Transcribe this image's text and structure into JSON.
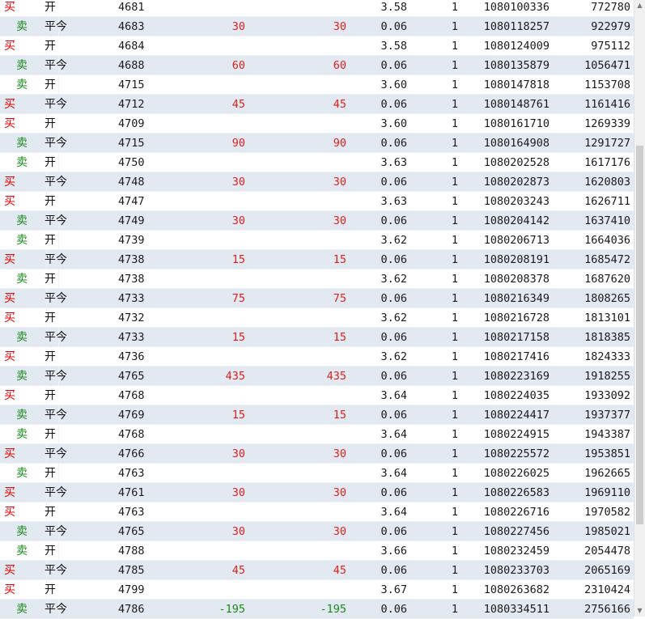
{
  "colors": {
    "buy": "#e60000",
    "sell": "#1a8a1a",
    "row_alt": "#e3e9f1"
  },
  "rows": [
    {
      "side": "买",
      "oc": "开",
      "price": "4681",
      "pnl": "",
      "pnl2": "",
      "fee": "3.58",
      "qty": "1",
      "time": "1080100336",
      "idx": "772780"
    },
    {
      "side": "卖",
      "oc": "平今",
      "price": "4683",
      "pnl": "30",
      "pnl2": "30",
      "fee": "0.06",
      "qty": "1",
      "time": "1080118257",
      "idx": "922979"
    },
    {
      "side": "买",
      "oc": "开",
      "price": "4684",
      "pnl": "",
      "pnl2": "",
      "fee": "3.58",
      "qty": "1",
      "time": "1080124009",
      "idx": "975112"
    },
    {
      "side": "卖",
      "oc": "平今",
      "price": "4688",
      "pnl": "60",
      "pnl2": "60",
      "fee": "0.06",
      "qty": "1",
      "time": "1080135879",
      "idx": "1056471"
    },
    {
      "side": "卖",
      "oc": "开",
      "price": "4715",
      "pnl": "",
      "pnl2": "",
      "fee": "3.60",
      "qty": "1",
      "time": "1080147818",
      "idx": "1153708"
    },
    {
      "side": "买",
      "oc": "平今",
      "price": "4712",
      "pnl": "45",
      "pnl2": "45",
      "fee": "0.06",
      "qty": "1",
      "time": "1080148761",
      "idx": "1161416"
    },
    {
      "side": "买",
      "oc": "开",
      "price": "4709",
      "pnl": "",
      "pnl2": "",
      "fee": "3.60",
      "qty": "1",
      "time": "1080161710",
      "idx": "1269339"
    },
    {
      "side": "卖",
      "oc": "平今",
      "price": "4715",
      "pnl": "90",
      "pnl2": "90",
      "fee": "0.06",
      "qty": "1",
      "time": "1080164908",
      "idx": "1291727"
    },
    {
      "side": "卖",
      "oc": "开",
      "price": "4750",
      "pnl": "",
      "pnl2": "",
      "fee": "3.63",
      "qty": "1",
      "time": "1080202528",
      "idx": "1617176"
    },
    {
      "side": "买",
      "oc": "平今",
      "price": "4748",
      "pnl": "30",
      "pnl2": "30",
      "fee": "0.06",
      "qty": "1",
      "time": "1080202873",
      "idx": "1620803"
    },
    {
      "side": "买",
      "oc": "开",
      "price": "4747",
      "pnl": "",
      "pnl2": "",
      "fee": "3.63",
      "qty": "1",
      "time": "1080203243",
      "idx": "1626711"
    },
    {
      "side": "卖",
      "oc": "平今",
      "price": "4749",
      "pnl": "30",
      "pnl2": "30",
      "fee": "0.06",
      "qty": "1",
      "time": "1080204142",
      "idx": "1637410"
    },
    {
      "side": "卖",
      "oc": "开",
      "price": "4739",
      "pnl": "",
      "pnl2": "",
      "fee": "3.62",
      "qty": "1",
      "time": "1080206713",
      "idx": "1664036"
    },
    {
      "side": "买",
      "oc": "平今",
      "price": "4738",
      "pnl": "15",
      "pnl2": "15",
      "fee": "0.06",
      "qty": "1",
      "time": "1080208191",
      "idx": "1685472"
    },
    {
      "side": "卖",
      "oc": "开",
      "price": "4738",
      "pnl": "",
      "pnl2": "",
      "fee": "3.62",
      "qty": "1",
      "time": "1080208378",
      "idx": "1687620"
    },
    {
      "side": "买",
      "oc": "平今",
      "price": "4733",
      "pnl": "75",
      "pnl2": "75",
      "fee": "0.06",
      "qty": "1",
      "time": "1080216349",
      "idx": "1808265"
    },
    {
      "side": "买",
      "oc": "开",
      "price": "4732",
      "pnl": "",
      "pnl2": "",
      "fee": "3.62",
      "qty": "1",
      "time": "1080216728",
      "idx": "1813101"
    },
    {
      "side": "卖",
      "oc": "平今",
      "price": "4733",
      "pnl": "15",
      "pnl2": "15",
      "fee": "0.06",
      "qty": "1",
      "time": "1080217158",
      "idx": "1818385"
    },
    {
      "side": "买",
      "oc": "开",
      "price": "4736",
      "pnl": "",
      "pnl2": "",
      "fee": "3.62",
      "qty": "1",
      "time": "1080217416",
      "idx": "1824333"
    },
    {
      "side": "卖",
      "oc": "平今",
      "price": "4765",
      "pnl": "435",
      "pnl2": "435",
      "fee": "0.06",
      "qty": "1",
      "time": "1080223169",
      "idx": "1918255"
    },
    {
      "side": "买",
      "oc": "开",
      "price": "4768",
      "pnl": "",
      "pnl2": "",
      "fee": "3.64",
      "qty": "1",
      "time": "1080224035",
      "idx": "1933092"
    },
    {
      "side": "卖",
      "oc": "平今",
      "price": "4769",
      "pnl": "15",
      "pnl2": "15",
      "fee": "0.06",
      "qty": "1",
      "time": "1080224417",
      "idx": "1937377"
    },
    {
      "side": "卖",
      "oc": "开",
      "price": "4768",
      "pnl": "",
      "pnl2": "",
      "fee": "3.64",
      "qty": "1",
      "time": "1080224915",
      "idx": "1943387"
    },
    {
      "side": "买",
      "oc": "平今",
      "price": "4766",
      "pnl": "30",
      "pnl2": "30",
      "fee": "0.06",
      "qty": "1",
      "time": "1080225572",
      "idx": "1953851"
    },
    {
      "side": "卖",
      "oc": "开",
      "price": "4763",
      "pnl": "",
      "pnl2": "",
      "fee": "3.64",
      "qty": "1",
      "time": "1080226025",
      "idx": "1962665"
    },
    {
      "side": "买",
      "oc": "平今",
      "price": "4761",
      "pnl": "30",
      "pnl2": "30",
      "fee": "0.06",
      "qty": "1",
      "time": "1080226583",
      "idx": "1969110"
    },
    {
      "side": "买",
      "oc": "开",
      "price": "4763",
      "pnl": "",
      "pnl2": "",
      "fee": "3.64",
      "qty": "1",
      "time": "1080226716",
      "idx": "1970582"
    },
    {
      "side": "卖",
      "oc": "平今",
      "price": "4765",
      "pnl": "30",
      "pnl2": "30",
      "fee": "0.06",
      "qty": "1",
      "time": "1080227456",
      "idx": "1985021"
    },
    {
      "side": "卖",
      "oc": "开",
      "price": "4788",
      "pnl": "",
      "pnl2": "",
      "fee": "3.66",
      "qty": "1",
      "time": "1080232459",
      "idx": "2054478"
    },
    {
      "side": "买",
      "oc": "平今",
      "price": "4785",
      "pnl": "45",
      "pnl2": "45",
      "fee": "0.06",
      "qty": "1",
      "time": "1080233703",
      "idx": "2065169"
    },
    {
      "side": "买",
      "oc": "开",
      "price": "4799",
      "pnl": "",
      "pnl2": "",
      "fee": "3.67",
      "qty": "1",
      "time": "1080263682",
      "idx": "2310424"
    },
    {
      "side": "卖",
      "oc": "平今",
      "price": "4786",
      "pnl": "-195",
      "pnl2": "-195",
      "fee": "0.06",
      "qty": "1",
      "time": "1080334511",
      "idx": "2756166"
    }
  ],
  "scrollbar": {
    "up_icon": "arrow-up-icon",
    "down_icon": "arrow-down-icon"
  }
}
